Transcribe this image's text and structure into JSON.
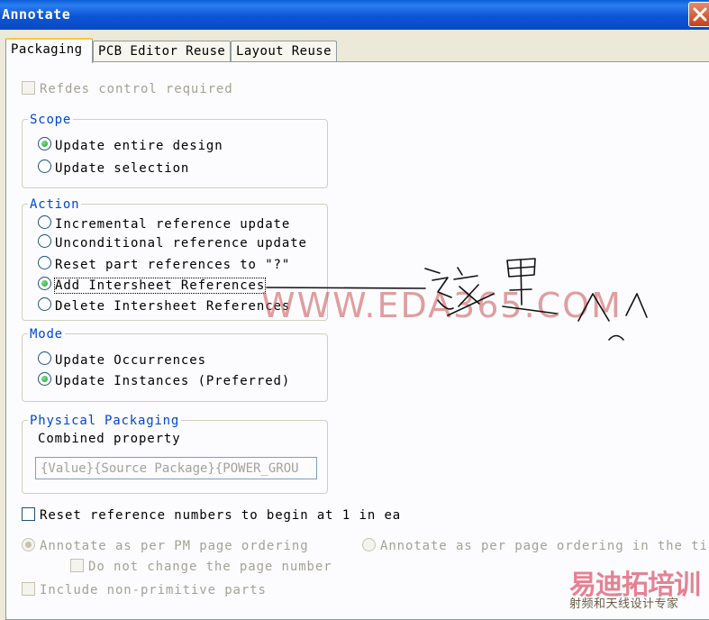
{
  "window": {
    "title": "Annotate"
  },
  "tabs": [
    {
      "label": "Packaging"
    },
    {
      "label": "PCB Editor Reuse"
    },
    {
      "label": "Layout Reuse"
    }
  ],
  "refdes_control": {
    "label": "Refdes control required",
    "checked": false,
    "enabled": false
  },
  "scope": {
    "legend": "Scope",
    "options": [
      {
        "label": "Update entire design",
        "selected": true
      },
      {
        "label": "Update selection",
        "selected": false
      }
    ]
  },
  "action": {
    "legend": "Action",
    "options": [
      {
        "label": "Incremental reference update",
        "selected": false
      },
      {
        "label": "Unconditional reference update",
        "selected": false
      },
      {
        "label": "Reset part references to \"?\"",
        "selected": false
      },
      {
        "label": "Add Intersheet References",
        "selected": true
      },
      {
        "label": "Delete Intersheet References",
        "selected": false
      }
    ]
  },
  "mode": {
    "legend": "Mode",
    "options": [
      {
        "label": "Update Occurrences",
        "selected": false
      },
      {
        "label": "Update Instances (Preferred)",
        "selected": true
      }
    ]
  },
  "physical_packaging": {
    "legend": "Physical Packaging",
    "combined_label": "Combined property",
    "combined_value": "{Value}{Source Package}{POWER_GROU"
  },
  "reset_numbers": {
    "label": "Reset reference numbers to begin at 1 in ea",
    "checked": false
  },
  "ordering": {
    "per_pm": {
      "label": "Annotate as per PM page ordering",
      "selected": true,
      "enabled": false
    },
    "per_page": {
      "label": "Annotate as per page ordering in the ti",
      "selected": false,
      "enabled": false
    },
    "do_not_change": {
      "label": "Do not change the page number",
      "checked": false,
      "enabled": false
    }
  },
  "non_primitive": {
    "label": "Include non-primitive parts",
    "checked": false,
    "enabled": false
  },
  "overlay": {
    "watermark": "WWW.EDA365.COM",
    "brand": "易迪拓培训",
    "brand_sub": "射频和天线设计专家"
  },
  "colors": {
    "accent": "#0046d5",
    "radio_on": "#219b2d",
    "tab_highlight": "#ffc73c"
  }
}
